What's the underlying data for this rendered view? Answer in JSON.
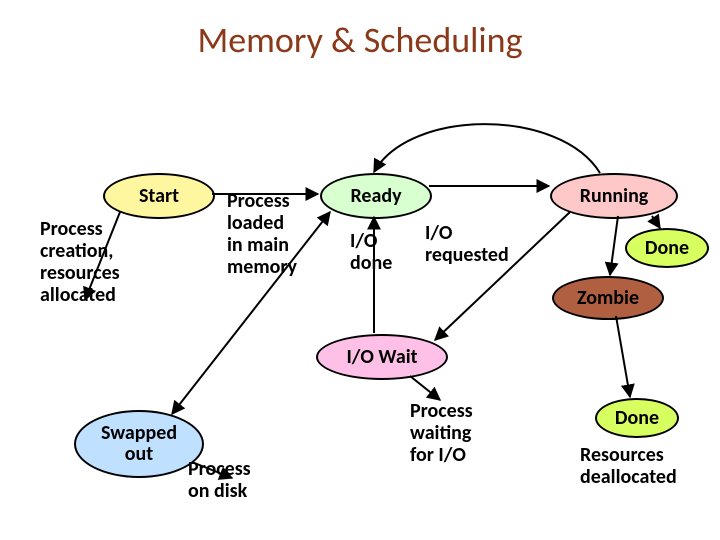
{
  "title": "Memory & Scheduling",
  "states": {
    "start": "Start",
    "ready": "Ready",
    "running": "Running",
    "iowait": "I/O Wait",
    "swapped": "Swapped\nout",
    "zombie": "Zombie",
    "done_upper": "Done",
    "done_lower": "Done"
  },
  "labels": {
    "proc_creation": "Process\ncreation,\nresources\nallocated",
    "proc_loaded": "Process\nloaded\nin main\nmemory",
    "io_done": "I/O\ndone",
    "io_requested": "I/O\nrequested",
    "proc_waiting": "Process\nwaiting\nfor I/O",
    "proc_on_disk": "Process\non disk",
    "res_dealloc": "Resources\ndeallocated"
  },
  "chart_data": {
    "type": "state-diagram",
    "title": "Memory & Scheduling",
    "nodes": [
      {
        "id": "start",
        "label": "Start",
        "color": "#fff7a0"
      },
      {
        "id": "ready",
        "label": "Ready",
        "color": "#d8ffd0"
      },
      {
        "id": "running",
        "label": "Running",
        "color": "#ffc8c8"
      },
      {
        "id": "iowait",
        "label": "I/O Wait",
        "color": "#ffc0e8"
      },
      {
        "id": "swapped",
        "label": "Swapped out",
        "color": "#c0e0ff"
      },
      {
        "id": "zombie",
        "label": "Zombie",
        "color": "#b06040"
      },
      {
        "id": "done",
        "label": "Done",
        "color": "#d8ff60"
      }
    ],
    "edges": [
      {
        "from": "start",
        "to": "ready",
        "label": "Process loaded in main memory"
      },
      {
        "from": "start",
        "to": "annotation",
        "label": "Process creation, resources allocated"
      },
      {
        "from": "ready",
        "to": "running",
        "label": ""
      },
      {
        "from": "running",
        "to": "ready",
        "label": ""
      },
      {
        "from": "running",
        "to": "iowait",
        "label": "I/O requested"
      },
      {
        "from": "iowait",
        "to": "ready",
        "label": "I/O done"
      },
      {
        "from": "iowait",
        "to": "annotation",
        "label": "Process waiting for I/O"
      },
      {
        "from": "ready",
        "to": "swapped",
        "label": ""
      },
      {
        "from": "swapped",
        "to": "ready",
        "label": "Process on disk"
      },
      {
        "from": "running",
        "to": "zombie",
        "label": ""
      },
      {
        "from": "zombie",
        "to": "done",
        "label": "Resources deallocated"
      },
      {
        "from": "running",
        "to": "done",
        "label": ""
      }
    ]
  }
}
